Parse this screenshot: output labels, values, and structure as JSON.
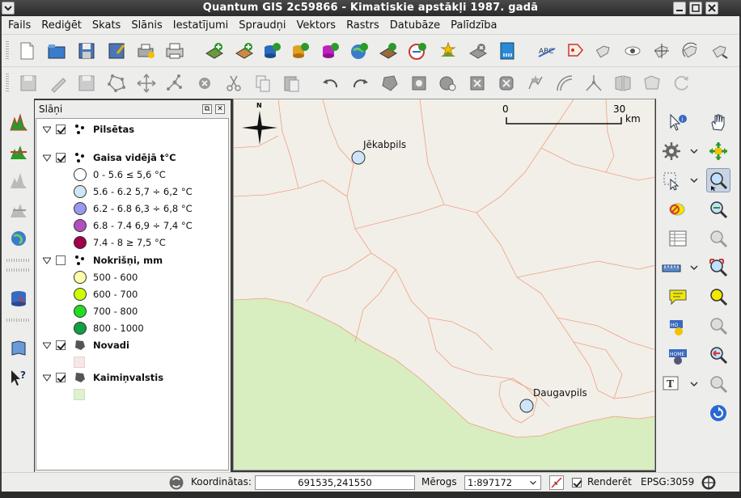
{
  "window": {
    "title": "Quantum GIS 2c59866 - Kimatiskie apstākļi 1987. gadā"
  },
  "menu": [
    "Fails",
    "Rediģēt",
    "Skats",
    "Slānis",
    "Iestatījumi",
    "Spraudņi",
    "Vektors",
    "Rastrs",
    "Datubāze",
    "Palīdzība"
  ],
  "layers_panel": {
    "title": "Slāņi",
    "layers": [
      {
        "name": "Pilsētas",
        "checked": true
      },
      {
        "name": "Gaisa vidējā t°C",
        "checked": true,
        "classes": [
          {
            "label": "0 - 5.6 ≤ 5,6 °C",
            "color": "#ffffff"
          },
          {
            "label": "5.6 - 6.2 5,7 ÷ 6,2 °C",
            "color": "#cfe4f7"
          },
          {
            "label": "6.2 - 6.8 6,3 ÷ 6,8 °C",
            "color": "#9999ee"
          },
          {
            "label": "6.8 - 7.4 6,9 ÷ 7,4 °C",
            "color": "#b050c0"
          },
          {
            "label": "7.4 - 8 ≥ 7,5 °C",
            "color": "#a0004a"
          }
        ]
      },
      {
        "name": "Nokrišņi, mm",
        "checked": false,
        "classes": [
          {
            "label": "500 - 600",
            "color": "#ffffaa"
          },
          {
            "label": "600 - 700",
            "color": "#ccff00"
          },
          {
            "label": "700 - 800",
            "color": "#22dd22"
          },
          {
            "label": "800 - 1000",
            "color": "#10a040"
          }
        ]
      },
      {
        "name": "Novadi",
        "checked": true,
        "swatch": "#f5e8e8"
      },
      {
        "name": "Kaimiņvalstis",
        "checked": true,
        "swatch": "#e0f0d0"
      }
    ]
  },
  "map": {
    "cities": [
      {
        "name": "Jēkabpils"
      },
      {
        "name": "Daugavpils"
      }
    ],
    "scale": {
      "start": "0",
      "end": "30",
      "unit": "km"
    },
    "north": "N",
    "colors": {
      "land": "#f2efe9",
      "neighbor": "#d8edc0",
      "border": "#f0a080",
      "city": "#cfe4f7"
    }
  },
  "status": {
    "coord_label": "Koordinātas:",
    "coord_value": "691535,241550",
    "scale_label": "Mērogs",
    "scale_value": "1:897172",
    "render_label": "Renderēt",
    "render_checked": true,
    "crs": "EPSG:3059"
  }
}
